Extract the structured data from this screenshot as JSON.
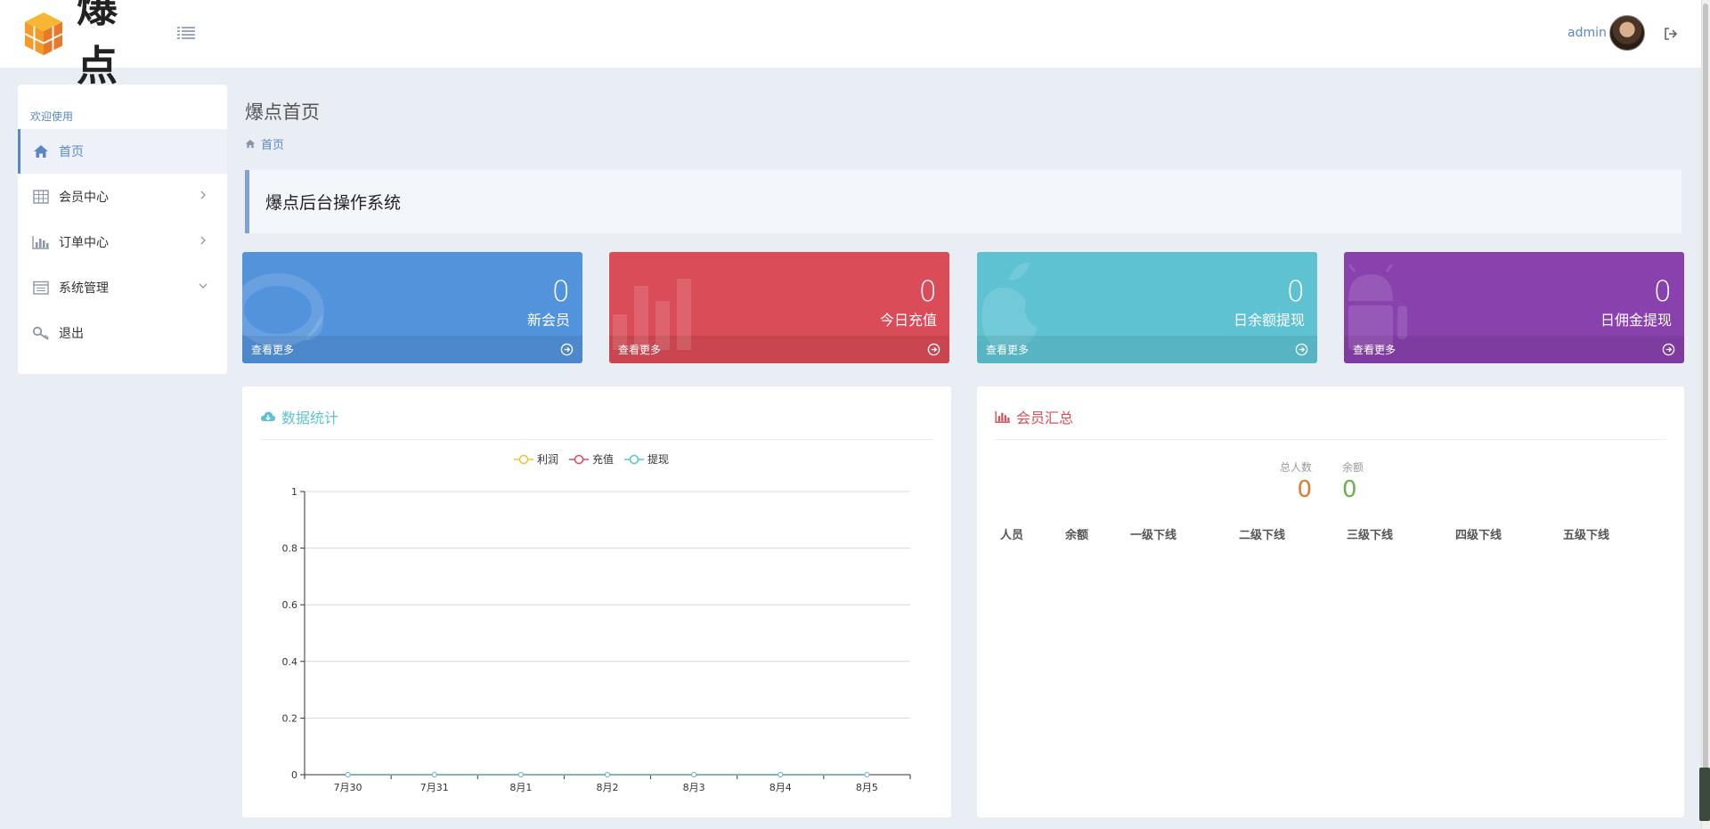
{
  "header": {
    "logo_text": "爆点",
    "user_name": "admin",
    "colors": {
      "logo_orange": "#f39a2b",
      "accent": "#5a88c6"
    }
  },
  "sidebar": {
    "title": "欢迎使用",
    "items": [
      {
        "label": "首页",
        "icon": "home-icon",
        "active": true
      },
      {
        "label": "会员中心",
        "icon": "table-icon",
        "expand": "chevron-right-icon"
      },
      {
        "label": "订单中心",
        "icon": "bar-chart-icon",
        "expand": "chevron-right-icon"
      },
      {
        "label": "系统管理",
        "icon": "calendar-icon",
        "expand": "chevron-down-icon"
      },
      {
        "label": "退出",
        "icon": "key-icon"
      }
    ]
  },
  "main": {
    "page_title": "爆点首页",
    "breadcrumb": "首页",
    "banner": "爆点后台操作系统"
  },
  "cards": [
    {
      "value": "0",
      "label": "新会员",
      "more": "查看更多",
      "color": "#5393dc"
    },
    {
      "value": "0",
      "label": "今日充值",
      "more": "查看更多",
      "color": "#d94c58"
    },
    {
      "value": "0",
      "label": "日余额提现",
      "more": "查看更多",
      "color": "#5ec2d2"
    },
    {
      "value": "0",
      "label": "日佣金提现",
      "more": "查看更多",
      "color": "#8841ad"
    }
  ],
  "stats_panel": {
    "title": "数据统计",
    "title_color": "#5ec2d2"
  },
  "chart_data": {
    "type": "line",
    "categories": [
      "7月30",
      "7月31",
      "8月1",
      "8月2",
      "8月3",
      "8月4",
      "8月5"
    ],
    "series": [
      {
        "name": "利润",
        "values": [
          0,
          0,
          0,
          0,
          0,
          0,
          0
        ],
        "color": "#f0c23a"
      },
      {
        "name": "充值",
        "values": [
          0,
          0,
          0,
          0,
          0,
          0,
          0
        ],
        "color": "#d94c58"
      },
      {
        "name": "提现",
        "values": [
          0,
          0,
          0,
          0,
          0,
          0,
          0
        ],
        "color": "#5ec2d2"
      }
    ],
    "y_ticks": [
      "0",
      "0.2",
      "0.4",
      "0.6",
      "0.8",
      "1"
    ],
    "ylim": [
      0,
      1
    ],
    "legend_position": "top-center",
    "grid": true
  },
  "member_panel": {
    "title": "会员汇总",
    "title_color": "#d94c58",
    "total_label": "总人数",
    "total_value": "0",
    "total_color": "#e07b2d",
    "balance_label": "余额",
    "balance_value": "0",
    "balance_color": "#6ab04c",
    "columns": [
      "人员",
      "余额",
      "一级下线",
      "二级下线",
      "三级下线",
      "四级下线",
      "五级下线"
    ]
  }
}
